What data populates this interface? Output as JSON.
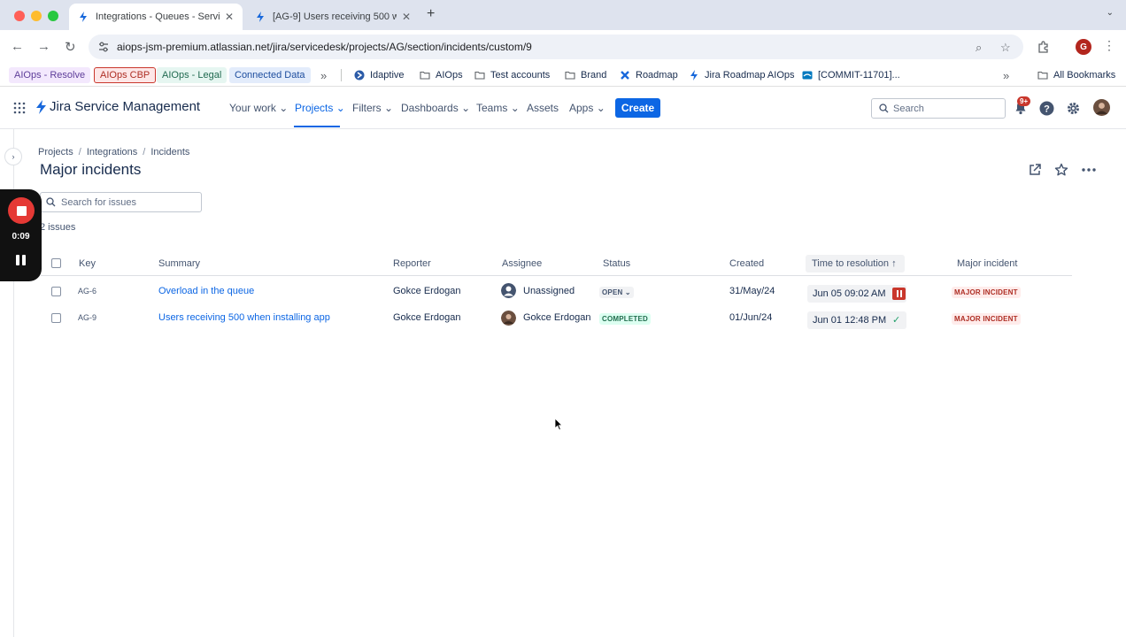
{
  "browser": {
    "tabs": [
      {
        "title": "Integrations - Queues - Servi",
        "active": true
      },
      {
        "title": "[AG-9] Users receiving 500 w",
        "active": false
      }
    ],
    "url": "aiops-jsm-premium.atlassian.net/jira/servicedesk/projects/AG/section/incidents/custom/9",
    "profile_initial": "G",
    "bookmarks_pills": [
      {
        "label": "AIOps - Resolve",
        "bg": "#f3e8fd",
        "color": "#5e3d99"
      },
      {
        "label": "AIOps CBP",
        "bg": "#fde7e7",
        "color": "#ae2e24"
      },
      {
        "label": "AIOps - Legal",
        "bg": "#e6f6f1",
        "color": "#206a50"
      },
      {
        "label": "Connected Data",
        "bg": "#e3ecfb",
        "color": "#1d4d9e"
      }
    ],
    "bookmarks": [
      {
        "label": "Idaptive"
      },
      {
        "label": "AIOps"
      },
      {
        "label": "Test accounts"
      },
      {
        "label": "Brand"
      },
      {
        "label": "Roadmap"
      },
      {
        "label": "Jira Roadmap AIOps"
      },
      {
        "label": "[COMMIT-11701]..."
      }
    ],
    "all_bookmarks": "All Bookmarks"
  },
  "jira": {
    "product": "Jira Service Management",
    "nav": {
      "your_work": "Your work",
      "projects": "Projects",
      "filters": "Filters",
      "dashboards": "Dashboards",
      "teams": "Teams",
      "assets": "Assets",
      "apps": "Apps",
      "create": "Create",
      "search_placeholder": "Search",
      "notif_count": "9+"
    }
  },
  "page": {
    "breadcrumb": [
      "Projects",
      "Integrations",
      "Incidents"
    ],
    "title": "Major incidents",
    "search_placeholder": "Search for issues",
    "issue_count": "2 issues"
  },
  "recorder": {
    "time": "0:09"
  },
  "table": {
    "headers": {
      "key": "Key",
      "summary": "Summary",
      "reporter": "Reporter",
      "assignee": "Assignee",
      "status": "Status",
      "created": "Created",
      "time_to_resolution": "Time to resolution",
      "major_incident": "Major incident"
    },
    "rows": [
      {
        "key": "AG-6",
        "summary": "Overload in the queue",
        "reporter": "Gokce Erdogan",
        "assignee": "Unassigned",
        "status": "OPEN",
        "created": "31/May/24",
        "time_to_resolution": "Jun 05 09:02 AM",
        "sla_state": "paused",
        "major_incident": "MAJOR INCIDENT"
      },
      {
        "key": "AG-9",
        "summary": "Users receiving 500 when installing app",
        "reporter": "Gokce Erdogan",
        "assignee": "Gokce Erdogan",
        "status": "COMPLETED",
        "created": "01/Jun/24",
        "time_to_resolution": "Jun 01 12:48 PM",
        "sla_state": "met",
        "major_incident": "MAJOR INCIDENT"
      }
    ]
  }
}
